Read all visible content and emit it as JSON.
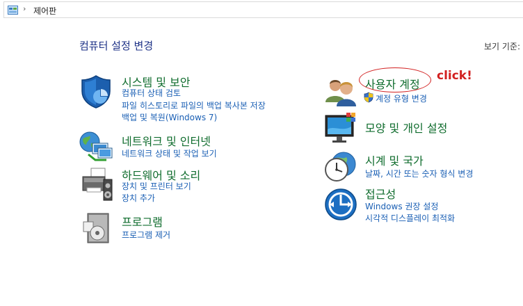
{
  "address": {
    "separator": "›",
    "location": "제어판"
  },
  "header": {
    "title": "컴퓨터 설정 변경",
    "view_by": "보기 기준:"
  },
  "categories": [
    {
      "title": "시스템 및 보안",
      "icon": "shield-icon",
      "links": [
        "컴퓨터 상태 검토",
        "파일 히스토리로 파일의 백업 복사본 저장",
        "백업 및 복원(Windows 7)"
      ]
    },
    {
      "title": "네트워크 및 인터넷",
      "icon": "network-icon",
      "links": [
        "네트워크 상태 및 작업 보기"
      ]
    },
    {
      "title": "하드웨어 및 소리",
      "icon": "printer-icon",
      "links": [
        "장치 및 프린터 보기",
        "장치 추가"
      ]
    },
    {
      "title": "프로그램",
      "icon": "programs-icon",
      "links": [
        "프로그램 제거"
      ]
    },
    {
      "title": "사용자 계정",
      "icon": "users-icon",
      "links": [
        "계정 유형 변경"
      ]
    },
    {
      "title": "모양 및 개인 설정",
      "icon": "appearance-icon",
      "links": []
    },
    {
      "title": "시계 및 국가",
      "icon": "clock-globe-icon",
      "links": [
        "날짜, 시간 또는 숫자 형식 변경"
      ]
    },
    {
      "title": "접근성",
      "icon": "accessibility-icon",
      "links": [
        "Windows 권장 설정",
        "시각적 디스플레이 최적화"
      ]
    }
  ],
  "annotation": {
    "text": "click!",
    "color": "#d22020"
  }
}
